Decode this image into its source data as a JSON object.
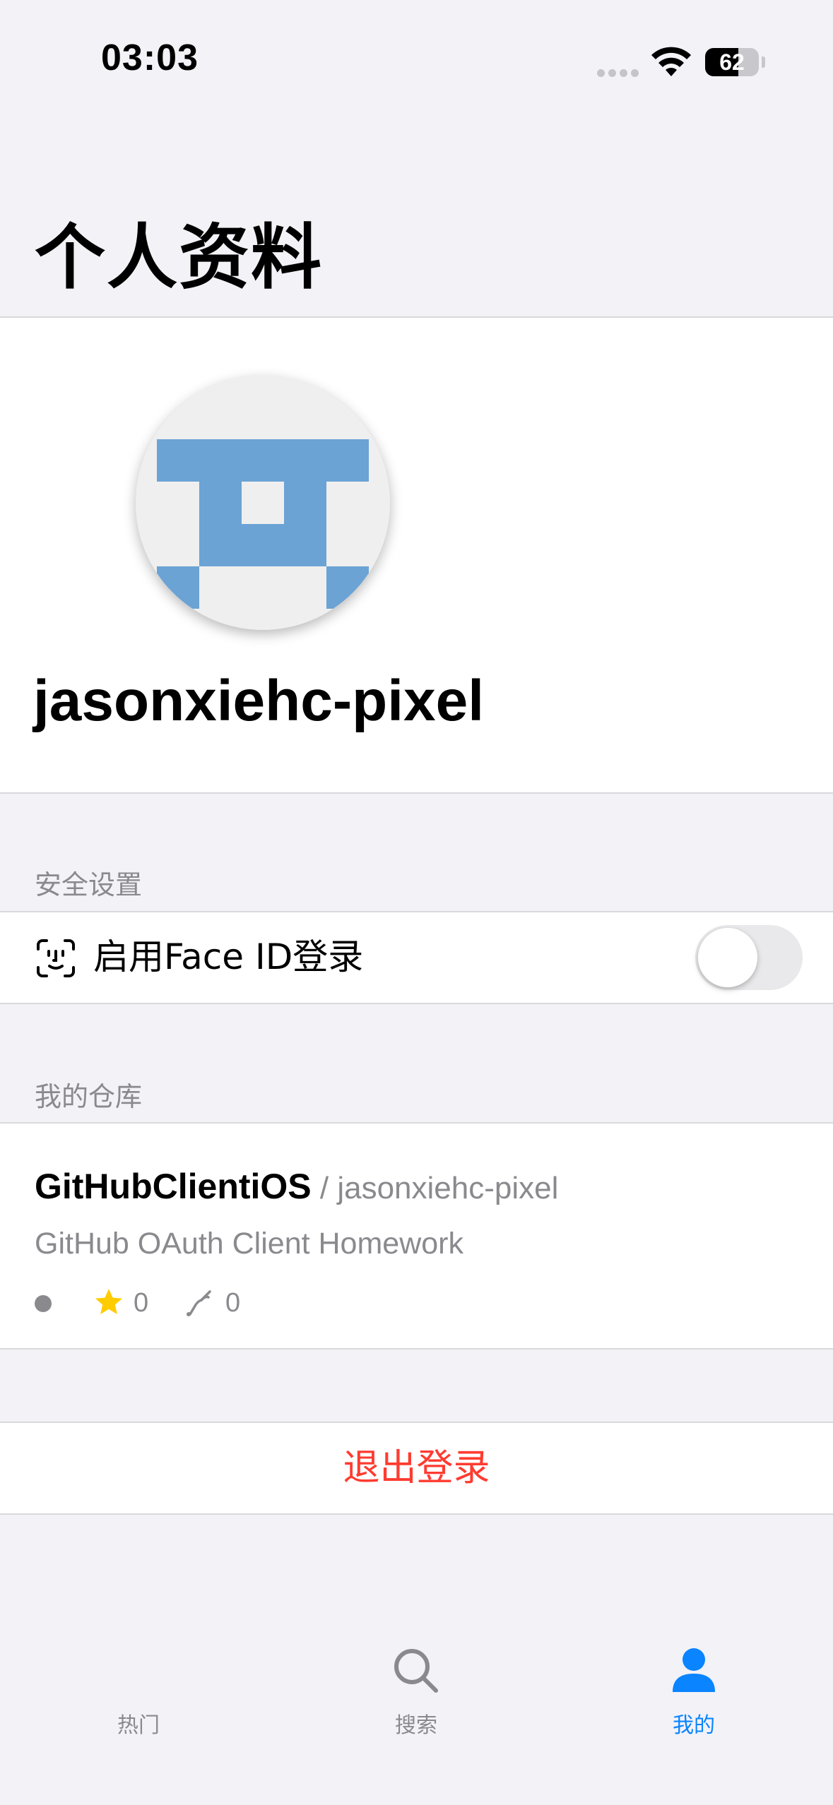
{
  "status_bar": {
    "time": "03:03",
    "battery": "62",
    "battery_level": 0.62
  },
  "page": {
    "title": "个人资料"
  },
  "profile": {
    "username": "jasonxiehc-pixel",
    "avatar_color": "#6ba3d4"
  },
  "security": {
    "header": "安全设置",
    "faceid_label": "启用Face ID登录",
    "faceid_enabled": false
  },
  "repos": {
    "header": "我的仓库",
    "items": [
      {
        "name": "GitHubClientiOS",
        "separator": " / ",
        "owner": "jasonxiehc-pixel",
        "description": "GitHub OAuth Client Homework",
        "stars": "0",
        "forks": "0"
      }
    ]
  },
  "logout": {
    "label": "退出登录",
    "color": "#ff3b30"
  },
  "tabbar": {
    "tabs": [
      {
        "label": "热门",
        "icon": "flame-icon",
        "active": false
      },
      {
        "label": "搜索",
        "icon": "search-icon",
        "active": false
      },
      {
        "label": "我的",
        "icon": "person-icon",
        "active": true
      }
    ],
    "active_color": "#0a84ff"
  }
}
